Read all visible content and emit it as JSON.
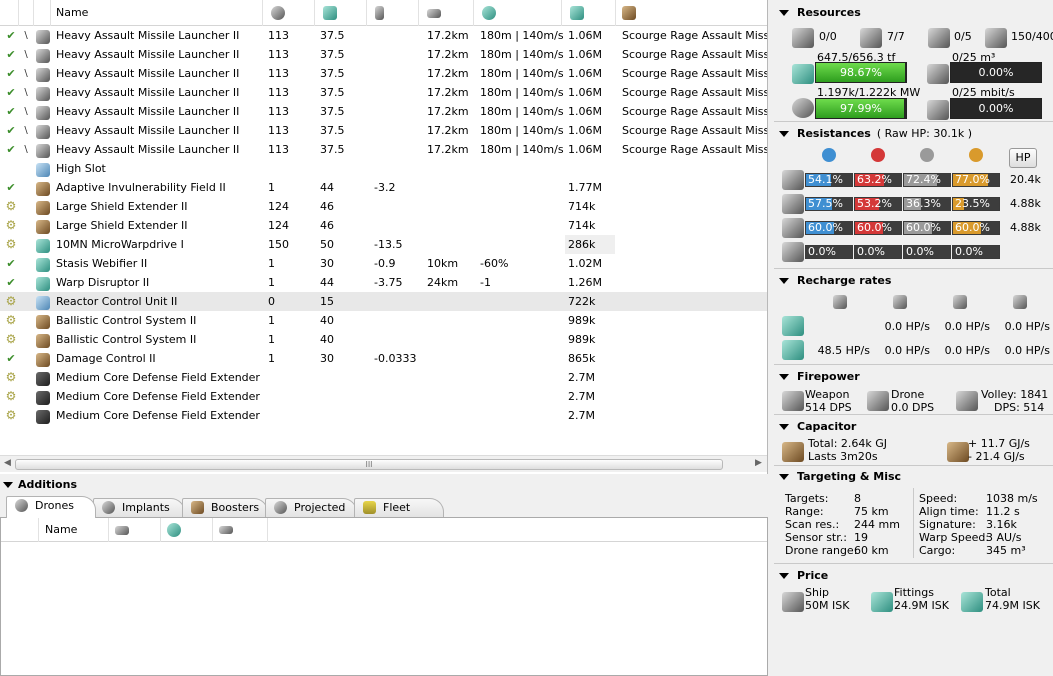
{
  "fitting": {
    "columns": [
      "Name"
    ],
    "column_icons": [
      "cpu-icon",
      "powergrid-icon",
      "capacitor-need-icon",
      "range-icon",
      "falloff-icon",
      "price-icon",
      "charge-icon"
    ],
    "rows": [
      {
        "state": "✔",
        "icon": "missile-launcher-icon",
        "tone": "gray",
        "charge": "\\",
        "name": "Heavy Assault Missile Launcher II",
        "cpu": "113",
        "pg": "37.5",
        "cap": "",
        "range": "17.2km",
        "falloff": "180m | 140m/s",
        "price": "1.06M",
        "charge_name": "Scourge Rage Assault Missile"
      },
      {
        "state": "✔",
        "icon": "missile-launcher-icon",
        "tone": "gray",
        "charge": "\\",
        "name": "Heavy Assault Missile Launcher II",
        "cpu": "113",
        "pg": "37.5",
        "cap": "",
        "range": "17.2km",
        "falloff": "180m | 140m/s",
        "price": "1.06M",
        "charge_name": "Scourge Rage Assault Missile"
      },
      {
        "state": "✔",
        "icon": "missile-launcher-icon",
        "tone": "gray",
        "charge": "\\",
        "name": "Heavy Assault Missile Launcher II",
        "cpu": "113",
        "pg": "37.5",
        "cap": "",
        "range": "17.2km",
        "falloff": "180m | 140m/s",
        "price": "1.06M",
        "charge_name": "Scourge Rage Assault Missile"
      },
      {
        "state": "✔",
        "icon": "missile-launcher-icon",
        "tone": "gray",
        "charge": "\\",
        "name": "Heavy Assault Missile Launcher II",
        "cpu": "113",
        "pg": "37.5",
        "cap": "",
        "range": "17.2km",
        "falloff": "180m | 140m/s",
        "price": "1.06M",
        "charge_name": "Scourge Rage Assault Missile"
      },
      {
        "state": "✔",
        "icon": "missile-launcher-icon",
        "tone": "gray",
        "charge": "\\",
        "name": "Heavy Assault Missile Launcher II",
        "cpu": "113",
        "pg": "37.5",
        "cap": "",
        "range": "17.2km",
        "falloff": "180m | 140m/s",
        "price": "1.06M",
        "charge_name": "Scourge Rage Assault Missile"
      },
      {
        "state": "✔",
        "icon": "missile-launcher-icon",
        "tone": "gray",
        "charge": "\\",
        "name": "Heavy Assault Missile Launcher II",
        "cpu": "113",
        "pg": "37.5",
        "cap": "",
        "range": "17.2km",
        "falloff": "180m | 140m/s",
        "price": "1.06M",
        "charge_name": "Scourge Rage Assault Missile"
      },
      {
        "state": "✔",
        "icon": "missile-launcher-icon",
        "tone": "gray",
        "charge": "\\",
        "name": "Heavy Assault Missile Launcher II",
        "cpu": "113",
        "pg": "37.5",
        "cap": "",
        "range": "17.2km",
        "falloff": "180m | 140m/s",
        "price": "1.06M",
        "charge_name": "Scourge Rage Assault Missile"
      },
      {
        "state": "",
        "icon": "high-slot-icon",
        "tone": "blue",
        "charge": "",
        "name": "High Slot",
        "cpu": "",
        "pg": "",
        "cap": "",
        "range": "",
        "falloff": "",
        "price": "",
        "charge_name": ""
      },
      {
        "state": "✔",
        "icon": "invulnerability-field-icon",
        "tone": "brown",
        "charge": "",
        "name": "Adaptive Invulnerability Field II",
        "cpu": "1",
        "pg": "44",
        "cap": "-3.2",
        "range": "",
        "falloff": "",
        "price": "1.77M",
        "charge_name": ""
      },
      {
        "state": "⚙",
        "icon": "shield-extender-icon",
        "tone": "brown",
        "charge": "",
        "name": "Large Shield Extender II",
        "cpu": "124",
        "pg": "46",
        "cap": "",
        "range": "",
        "falloff": "",
        "price": "714k",
        "charge_name": ""
      },
      {
        "state": "⚙",
        "icon": "shield-extender-icon",
        "tone": "brown",
        "charge": "",
        "name": "Large Shield Extender II",
        "cpu": "124",
        "pg": "46",
        "cap": "",
        "range": "",
        "falloff": "",
        "price": "714k",
        "charge_name": ""
      },
      {
        "state": "⚙",
        "icon": "microwarpdrive-icon",
        "tone": "teal",
        "charge": "",
        "name": "10MN MicroWarpdrive I",
        "cpu": "150",
        "pg": "50",
        "cap": "-13.5",
        "range": "",
        "falloff": "",
        "price": "286k",
        "charge_name": ""
      },
      {
        "state": "✔",
        "icon": "stasis-webifier-icon",
        "tone": "teal",
        "charge": "",
        "name": "Stasis Webifier II",
        "cpu": "1",
        "pg": "30",
        "cap": "-0.9",
        "range": "10km",
        "falloff": "-60%",
        "price": "1.02M",
        "charge_name": ""
      },
      {
        "state": "✔",
        "icon": "warp-disruptor-icon",
        "tone": "teal",
        "charge": "",
        "name": "Warp Disruptor II",
        "cpu": "1",
        "pg": "44",
        "cap": "-3.75",
        "range": "24km",
        "falloff": "-1",
        "price": "1.26M",
        "charge_name": ""
      },
      {
        "state": "⚙",
        "icon": "reactor-control-icon",
        "tone": "blue",
        "charge": "",
        "name": "Reactor Control Unit II",
        "cpu": "0",
        "pg": "15",
        "cap": "",
        "range": "",
        "falloff": "",
        "price": "722k",
        "charge_name": ""
      },
      {
        "state": "⚙",
        "icon": "ballistic-control-icon",
        "tone": "brown",
        "charge": "",
        "name": "Ballistic Control System II",
        "cpu": "1",
        "pg": "40",
        "cap": "",
        "range": "",
        "falloff": "",
        "price": "989k",
        "charge_name": ""
      },
      {
        "state": "⚙",
        "icon": "ballistic-control-icon",
        "tone": "brown",
        "charge": "",
        "name": "Ballistic Control System II",
        "cpu": "1",
        "pg": "40",
        "cap": "",
        "range": "",
        "falloff": "",
        "price": "989k",
        "charge_name": ""
      },
      {
        "state": "✔",
        "icon": "damage-control-icon",
        "tone": "brown",
        "charge": "",
        "name": "Damage Control II",
        "cpu": "1",
        "pg": "30",
        "cap": "-0.0333",
        "range": "",
        "falloff": "",
        "price": "865k",
        "charge_name": ""
      },
      {
        "state": "⚙",
        "icon": "core-defense-rig-icon",
        "tone": "dark",
        "charge": "",
        "name": "Medium Core Defense Field Extender I",
        "cpu": "",
        "pg": "",
        "cap": "",
        "range": "",
        "falloff": "",
        "price": "2.7M",
        "charge_name": ""
      },
      {
        "state": "⚙",
        "icon": "core-defense-rig-icon",
        "tone": "dark",
        "charge": "",
        "name": "Medium Core Defense Field Extender I",
        "cpu": "",
        "pg": "",
        "cap": "",
        "range": "",
        "falloff": "",
        "price": "2.7M",
        "charge_name": ""
      },
      {
        "state": "⚙",
        "icon": "core-defense-rig-icon",
        "tone": "dark",
        "charge": "",
        "name": "Medium Core Defense Field Extender I",
        "cpu": "",
        "pg": "",
        "cap": "",
        "range": "",
        "falloff": "",
        "price": "2.7M",
        "charge_name": ""
      }
    ],
    "selected_row": 14,
    "scroll_grip": "III"
  },
  "additions": {
    "title": "Additions",
    "tabs": [
      {
        "label": "Drones",
        "icon": "drone-icon"
      },
      {
        "label": "Implants",
        "icon": "implant-icon"
      },
      {
        "label": "Boosters",
        "icon": "booster-icon"
      },
      {
        "label": "Projected",
        "icon": "projected-icon"
      },
      {
        "label": "Fleet",
        "icon": "fleet-icon"
      }
    ],
    "active_tab": 0,
    "columns": [
      "Name"
    ],
    "column_icons": [
      "drone-bandwidth-icon",
      "drone-speed-icon",
      "drone-control-icon"
    ]
  },
  "resources": {
    "title": "Resources",
    "turrets": "0/0",
    "launchers": "7/7",
    "drones_active": "0/5",
    "calibration": "150/400",
    "cpu_text": "647.5/656.3 tf",
    "cpu_pct": "98.67%",
    "cpu_fraction": 0.9867,
    "power_text": "1.197k/1.222k MW",
    "power_pct": "97.99%",
    "power_fraction": 0.9799,
    "drone_bay_text": "0/25 m³",
    "drone_bay_pct": "0.00%",
    "drone_bandwidth_text": "0/25 mbit/s",
    "drone_bandwidth_pct": "0.00%"
  },
  "resistances": {
    "title": "Resistances",
    "raw_hp": "( Raw HP: 30.1k )",
    "hp_button": "HP",
    "damage_icons": [
      "em-icon",
      "thermal-icon",
      "kinetic-icon",
      "explosive-icon"
    ],
    "colors": [
      "#3f8fd2",
      "#d43838",
      "#9a9a9a",
      "#d99a2c"
    ],
    "rows": [
      {
        "icon": "shield-hp-icon",
        "values": [
          "54.1%",
          "63.2%",
          "72.4%",
          "77.0%"
        ],
        "fractions": [
          0.541,
          0.632,
          0.724,
          0.77
        ],
        "hp": "20.4k"
      },
      {
        "icon": "armor-hp-icon",
        "values": [
          "57.5%",
          "53.2%",
          "36.3%",
          "23.5%"
        ],
        "fractions": [
          0.575,
          0.532,
          0.363,
          0.235
        ],
        "hp": "4.88k"
      },
      {
        "icon": "hull-hp-icon",
        "values": [
          "60.0%",
          "60.0%",
          "60.0%",
          "60.0%"
        ],
        "fractions": [
          0.6,
          0.6,
          0.6,
          0.6
        ],
        "hp": "4.88k"
      },
      {
        "icon": "damage-pattern-icon",
        "values": [
          "0.0%",
          "0.0%",
          "0.0%",
          "0.0%"
        ],
        "fractions": [
          0,
          0,
          0,
          0
        ],
        "hp": ""
      }
    ]
  },
  "recharge": {
    "title": "Recharge rates",
    "column_icons": [
      "shield-boost-icon",
      "armor-repair-icon",
      "hull-repair-icon",
      "passive-shield-icon"
    ],
    "rows": [
      {
        "icon": "local-repair-icon",
        "values": [
          "",
          "0.0 HP/s",
          "0.0 HP/s",
          "0.0 HP/s"
        ]
      },
      {
        "icon": "remote-repair-icon",
        "values": [
          "48.5 HP/s",
          "0.0 HP/s",
          "0.0 HP/s",
          "0.0 HP/s"
        ]
      }
    ]
  },
  "firepower": {
    "title": "Firepower",
    "weapon_label": "Weapon",
    "weapon_dps": "514 DPS",
    "drone_label": "Drone",
    "drone_dps": "0.0 DPS",
    "volley": "Volley: 1841",
    "dps": "DPS: 514"
  },
  "capacitor": {
    "title": "Capacitor",
    "total": "Total: 2.64k GJ",
    "lasts": "Lasts 3m20s",
    "gain": "+ 11.7 GJ/s",
    "loss": "- 21.4 GJ/s"
  },
  "targeting": {
    "title": "Targeting & Misc",
    "left": [
      {
        "label": "Targets:",
        "value": "8"
      },
      {
        "label": "Range:",
        "value": "75 km"
      },
      {
        "label": "Scan res.:",
        "value": "244 mm"
      },
      {
        "label": "Sensor str.:",
        "value": "19"
      },
      {
        "label": "Drone range:",
        "value": "60 km"
      }
    ],
    "right": [
      {
        "label": "Speed:",
        "value": "1038 m/s"
      },
      {
        "label": "Align time:",
        "value": "11.2 s"
      },
      {
        "label": "Signature:",
        "value": "3.16k"
      },
      {
        "label": "Warp Speed:",
        "value": "3 AU/s"
      },
      {
        "label": "Cargo:",
        "value": "345 m³"
      }
    ]
  },
  "price": {
    "title": "Price",
    "ship_label": "Ship",
    "ship_value": "50M ISK",
    "fittings_label": "Fittings",
    "fittings_value": "24.9M ISK",
    "total_label": "Total",
    "total_value": "74.9M ISK"
  }
}
